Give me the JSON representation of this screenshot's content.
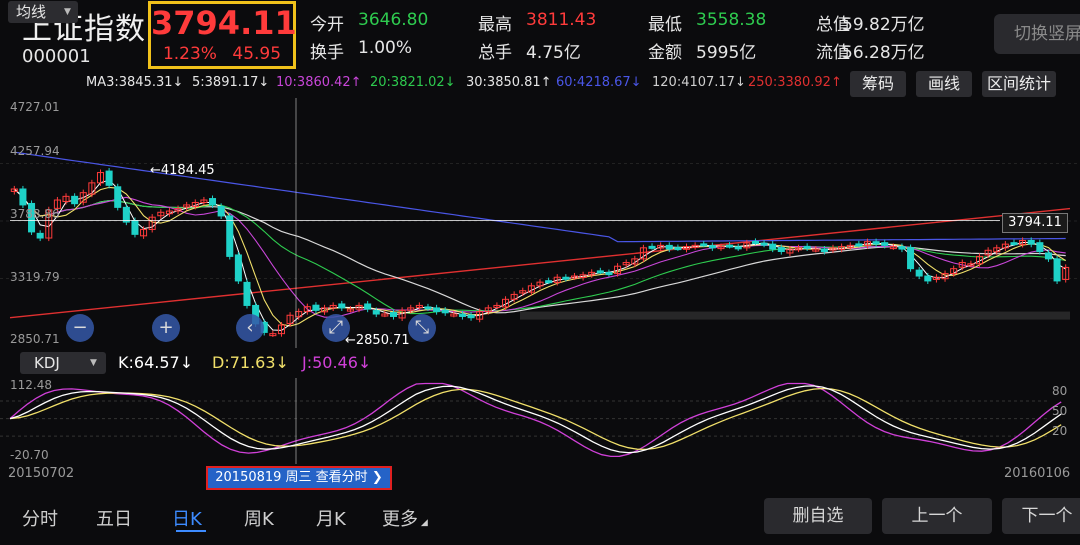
{
  "header": {
    "name": "上证指数",
    "code": "000001",
    "price": "3794.11",
    "change_pct": "1.23%",
    "change_pts": "45.95",
    "stats": [
      {
        "label": "今开",
        "value": "3646.80",
        "tone": "green"
      },
      {
        "label": "最高",
        "value": "3811.43",
        "tone": "red"
      },
      {
        "label": "最低",
        "value": "3558.38",
        "tone": "green"
      },
      {
        "label": "总值",
        "value": "59.82万亿",
        "tone": "white"
      },
      {
        "label": "换手",
        "value": "1.00%",
        "tone": "white"
      },
      {
        "label": "总手",
        "value": "4.75亿",
        "tone": "white"
      },
      {
        "label": "金额",
        "value": "5995亿",
        "tone": "white"
      },
      {
        "label": "流值",
        "value": "56.28万亿",
        "tone": "white"
      }
    ],
    "switch_label": "切换竖屏"
  },
  "ma_bar": {
    "selector": "均线",
    "items": [
      {
        "text": "MA3:3845.31↓",
        "color": "#e6e6e6"
      },
      {
        "text": "5:3891.17↓",
        "color": "#e6e6e6"
      },
      {
        "text": "10:3860.42↑",
        "color": "#c846d8"
      },
      {
        "text": "20:3821.02↓",
        "color": "#2ecb4f"
      },
      {
        "text": "30:3850.81↑",
        "color": "#e6e6e6"
      },
      {
        "text": "60:4218.67↓",
        "color": "#4a56e6"
      },
      {
        "text": "120:4107.17↓",
        "color": "#cfcfcf"
      },
      {
        "text": "250:3380.92↑",
        "color": "#e03030"
      }
    ],
    "buttons": [
      "筹码",
      "画线",
      "区间统计"
    ]
  },
  "price_axis": [
    "4727.01",
    "4257.94",
    "3788.86",
    "3319.79",
    "2850.71"
  ],
  "annotations": {
    "high": "←4184.45",
    "low": "←2850.71",
    "current": "3794.11"
  },
  "kdj": {
    "selector": "KDJ",
    "k": "K:64.57↓",
    "d": "D:71.63↓",
    "j": "J:50.46↓",
    "axis_left": [
      "112.48",
      "-20.70"
    ],
    "axis_right": [
      "80",
      "50",
      "20"
    ]
  },
  "dates": {
    "start": "20150702",
    "end": "20160106"
  },
  "tooltip": "20150819 周三 查看分时",
  "tabs": [
    "分时",
    "五日",
    "日K",
    "周K",
    "月K",
    "更多"
  ],
  "bottom_buttons": [
    "删自选",
    "上一个",
    "下一个"
  ],
  "chart_data": {
    "type": "line",
    "x_range": [
      "20150702",
      "20160106"
    ],
    "ylim": [
      2850.71,
      4727.01
    ],
    "highlighted_close": 3794.11,
    "markers": {
      "max": 4184.45,
      "min": 2850.71
    },
    "close": [
      4050,
      3920,
      3700,
      3650,
      3880,
      3960,
      3990,
      3930,
      4020,
      4100,
      4184,
      4080,
      3900,
      3780,
      3680,
      3720,
      3820,
      3860,
      3870,
      3890,
      3920,
      3940,
      3960,
      3920,
      3830,
      3500,
      3300,
      3100,
      2950,
      2880,
      2870,
      2940,
      3020,
      3050,
      3090,
      3060,
      3080,
      3100,
      3080,
      3070,
      3100,
      3070,
      3030,
      3030,
      3010,
      3060,
      3080,
      3100,
      3080,
      3050,
      3040,
      3030,
      3010,
      3000,
      3050,
      3080,
      3100,
      3150,
      3190,
      3220,
      3260,
      3290,
      3300,
      3330,
      3320,
      3340,
      3350,
      3370,
      3380,
      3360,
      3420,
      3450,
      3480,
      3570,
      3580,
      3590,
      3560,
      3570,
      3580,
      3590,
      3600,
      3570,
      3580,
      3590,
      3570,
      3610,
      3620,
      3600,
      3560,
      3540,
      3560,
      3570,
      3570,
      3560,
      3540,
      3570,
      3580,
      3590,
      3600,
      3620,
      3600,
      3590,
      3580,
      3560,
      3400,
      3340,
      3300,
      3330,
      3360,
      3400,
      3450,
      3440,
      3500,
      3550,
      3570,
      3600,
      3610,
      3630,
      3600,
      3540,
      3480,
      3300,
      3410
    ],
    "kdj": {
      "k": 64.57,
      "d": 71.63,
      "j": 50.46
    }
  }
}
